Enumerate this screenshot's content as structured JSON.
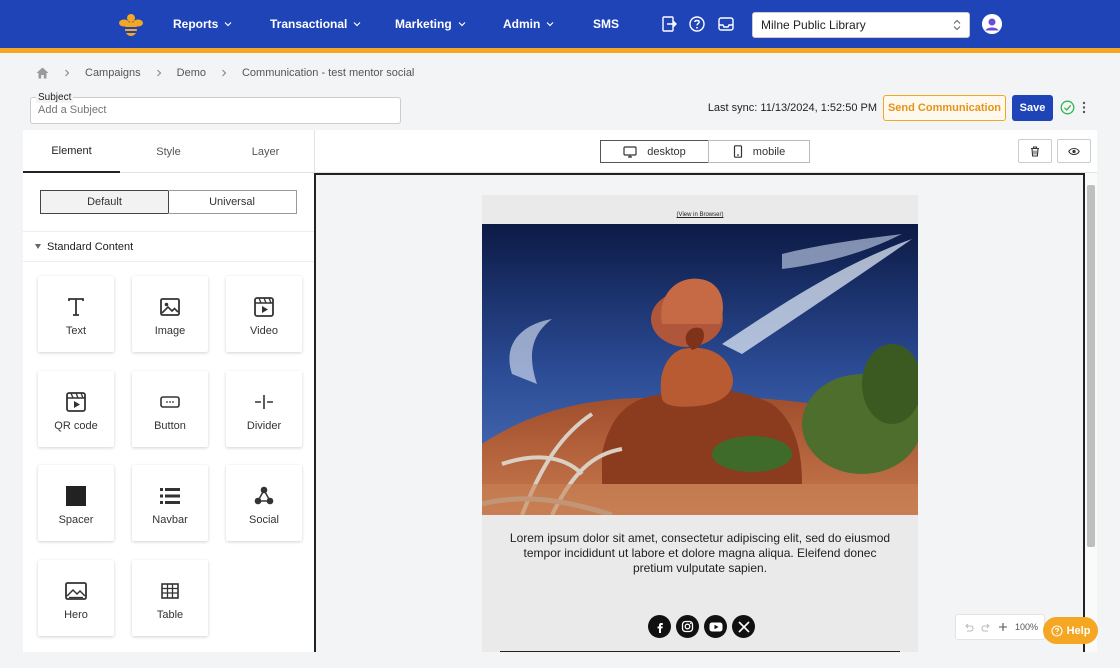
{
  "nav": {
    "items": [
      {
        "label": "Reports",
        "dropdown": true
      },
      {
        "label": "Transactional",
        "dropdown": true
      },
      {
        "label": "Marketing",
        "dropdown": true
      },
      {
        "label": "Admin",
        "dropdown": true
      },
      {
        "label": "SMS",
        "dropdown": false
      }
    ],
    "icons": [
      "sign-in-icon",
      "help-circle-icon",
      "inbox-icon"
    ],
    "org_select": "Milne Public Library",
    "colors": {
      "bar": "#1e44b8",
      "stripe": "#f5a623"
    }
  },
  "breadcrumb": [
    "Campaigns",
    "Demo",
    "Communication - test mentor social"
  ],
  "subject": {
    "label": "Subject",
    "placeholder": "Add a Subject"
  },
  "header_actions": {
    "last_sync": "Last sync: 11/13/2024, 1:52:50 PM",
    "send_label": "Send Communication",
    "save_label": "Save"
  },
  "panel": {
    "tabs": [
      "Element",
      "Style",
      "Layer"
    ],
    "active_tab": "Element",
    "scope": [
      "Default",
      "Universal"
    ],
    "section_title": "Standard Content",
    "elements": [
      {
        "label": "Text",
        "icon": "text-icon"
      },
      {
        "label": "Image",
        "icon": "image-icon"
      },
      {
        "label": "Video",
        "icon": "video-icon"
      },
      {
        "label": "QR code",
        "icon": "qr-code-icon"
      },
      {
        "label": "Button",
        "icon": "button-icon"
      },
      {
        "label": "Divider",
        "icon": "divider-icon"
      },
      {
        "label": "Spacer",
        "icon": "spacer-icon"
      },
      {
        "label": "Navbar",
        "icon": "navbar-icon"
      },
      {
        "label": "Social",
        "icon": "social-icon"
      },
      {
        "label": "Hero",
        "icon": "hero-icon"
      },
      {
        "label": "Table",
        "icon": "table-icon"
      }
    ]
  },
  "toolbar": {
    "devices": [
      "desktop",
      "mobile"
    ],
    "active_device": "desktop"
  },
  "email": {
    "view_in_browser": "(View in Browser)",
    "body": "Lorem ipsum dolor sit amet, consectetur adipiscing elit, sed do eiusmod tempor incididunt ut labore et dolore magna aliqua. Eleifend donec pretium vulputate sapien.",
    "social": [
      "facebook-icon",
      "instagram-icon",
      "youtube-icon",
      "x-icon"
    ]
  },
  "zoom": "100%",
  "help_label": "Help"
}
